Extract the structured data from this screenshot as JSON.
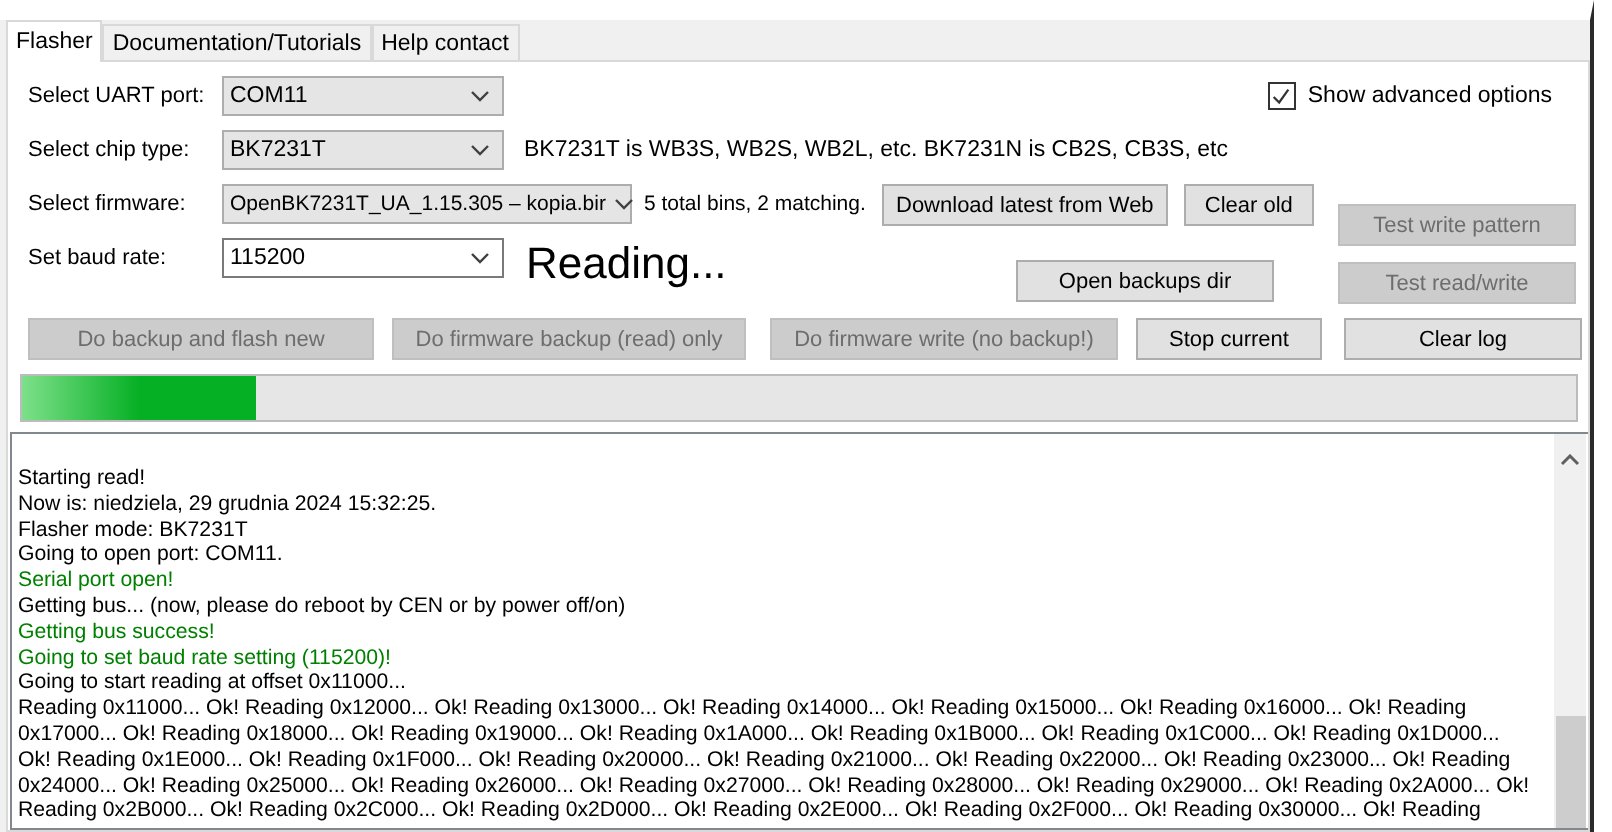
{
  "tabs": [
    {
      "label": "Flasher",
      "selected": true
    },
    {
      "label": "Documentation/Tutorials",
      "selected": false
    },
    {
      "label": "Help contact",
      "selected": false
    }
  ],
  "show_advanced": {
    "label": "Show advanced options",
    "checked": true
  },
  "fields": [
    {
      "label": "Select UART port:",
      "value": "COM11"
    },
    {
      "label": "Select chip type:",
      "value": "BK7231T"
    },
    {
      "label": "Select firmware:",
      "value": "OpenBK7231T_UA_1.15.305 – kopia.bir"
    },
    {
      "label": "Set baud rate:",
      "value": "115200"
    }
  ],
  "chip_note": "BK7231T is WB3S, WB2S, WB2L, etc. BK7231N is CB2S, CB3S, etc",
  "firmware_note": "5 total bins, 2 matching.",
  "firmware_buttons": [
    {
      "label": "Download latest from Web",
      "disabled": false
    },
    {
      "label": "Clear old",
      "disabled": false
    }
  ],
  "status": "Reading...",
  "advanced_buttons": [
    {
      "label": "Test write pattern",
      "disabled": true
    },
    {
      "label": "Open backups dir",
      "disabled": false
    },
    {
      "label": "Test read/write",
      "disabled": true
    }
  ],
  "action_buttons": [
    {
      "label": "Do backup and flash new",
      "disabled": true
    },
    {
      "label": "Do firmware backup (read) only",
      "disabled": true
    },
    {
      "label": "Do firmware write (no backup!)",
      "disabled": true
    },
    {
      "label": "Stop current",
      "disabled": false
    },
    {
      "label": "Clear log",
      "disabled": false
    }
  ],
  "progress": {
    "level": 0.15
  },
  "log": [
    {
      "text": "Starting read!",
      "kind": "info"
    },
    {
      "text": "Now is: niedziela, 29 grudnia 2024 15:32:25.",
      "kind": "info"
    },
    {
      "text": "Flasher mode: BK7231T",
      "kind": "info"
    },
    {
      "text": "Going to open port: COM11.",
      "kind": "info"
    },
    {
      "text": "Serial port open!",
      "kind": "success"
    },
    {
      "text": "Getting bus... (now, please do reboot by CEN or by power off/on)",
      "kind": "info"
    },
    {
      "text": "Getting bus success!",
      "kind": "success"
    },
    {
      "text": "Going to set baud rate setting (115200)!",
      "kind": "success"
    },
    {
      "text": "Going to start reading at offset 0x11000...",
      "kind": "info"
    },
    {
      "text": "Reading 0x11000... Ok! Reading 0x12000... Ok! Reading 0x13000... Ok! Reading 0x14000... Ok! Reading 0x15000... Ok! Reading 0x16000... Ok! Reading",
      "kind": "info"
    },
    {
      "text": "0x17000... Ok! Reading 0x18000... Ok! Reading 0x19000... Ok! Reading 0x1A000... Ok! Reading 0x1B000... Ok! Reading 0x1C000... Ok! Reading 0x1D000...",
      "kind": "info"
    },
    {
      "text": "Ok! Reading 0x1E000... Ok! Reading 0x1F000... Ok! Reading 0x20000... Ok! Reading 0x21000... Ok! Reading 0x22000... Ok! Reading 0x23000... Ok! Reading",
      "kind": "info"
    },
    {
      "text": "0x24000... Ok! Reading 0x25000... Ok! Reading 0x26000... Ok! Reading 0x27000... Ok! Reading 0x28000... Ok! Reading 0x29000... Ok! Reading 0x2A000... Ok!",
      "kind": "info"
    },
    {
      "text": "Reading 0x2B000... Ok! Reading 0x2C000... Ok! Reading 0x2D000... Ok! Reading 0x2E000... Ok! Reading 0x2F000... Ok! Reading 0x30000... Ok! Reading",
      "kind": "info"
    }
  ]
}
